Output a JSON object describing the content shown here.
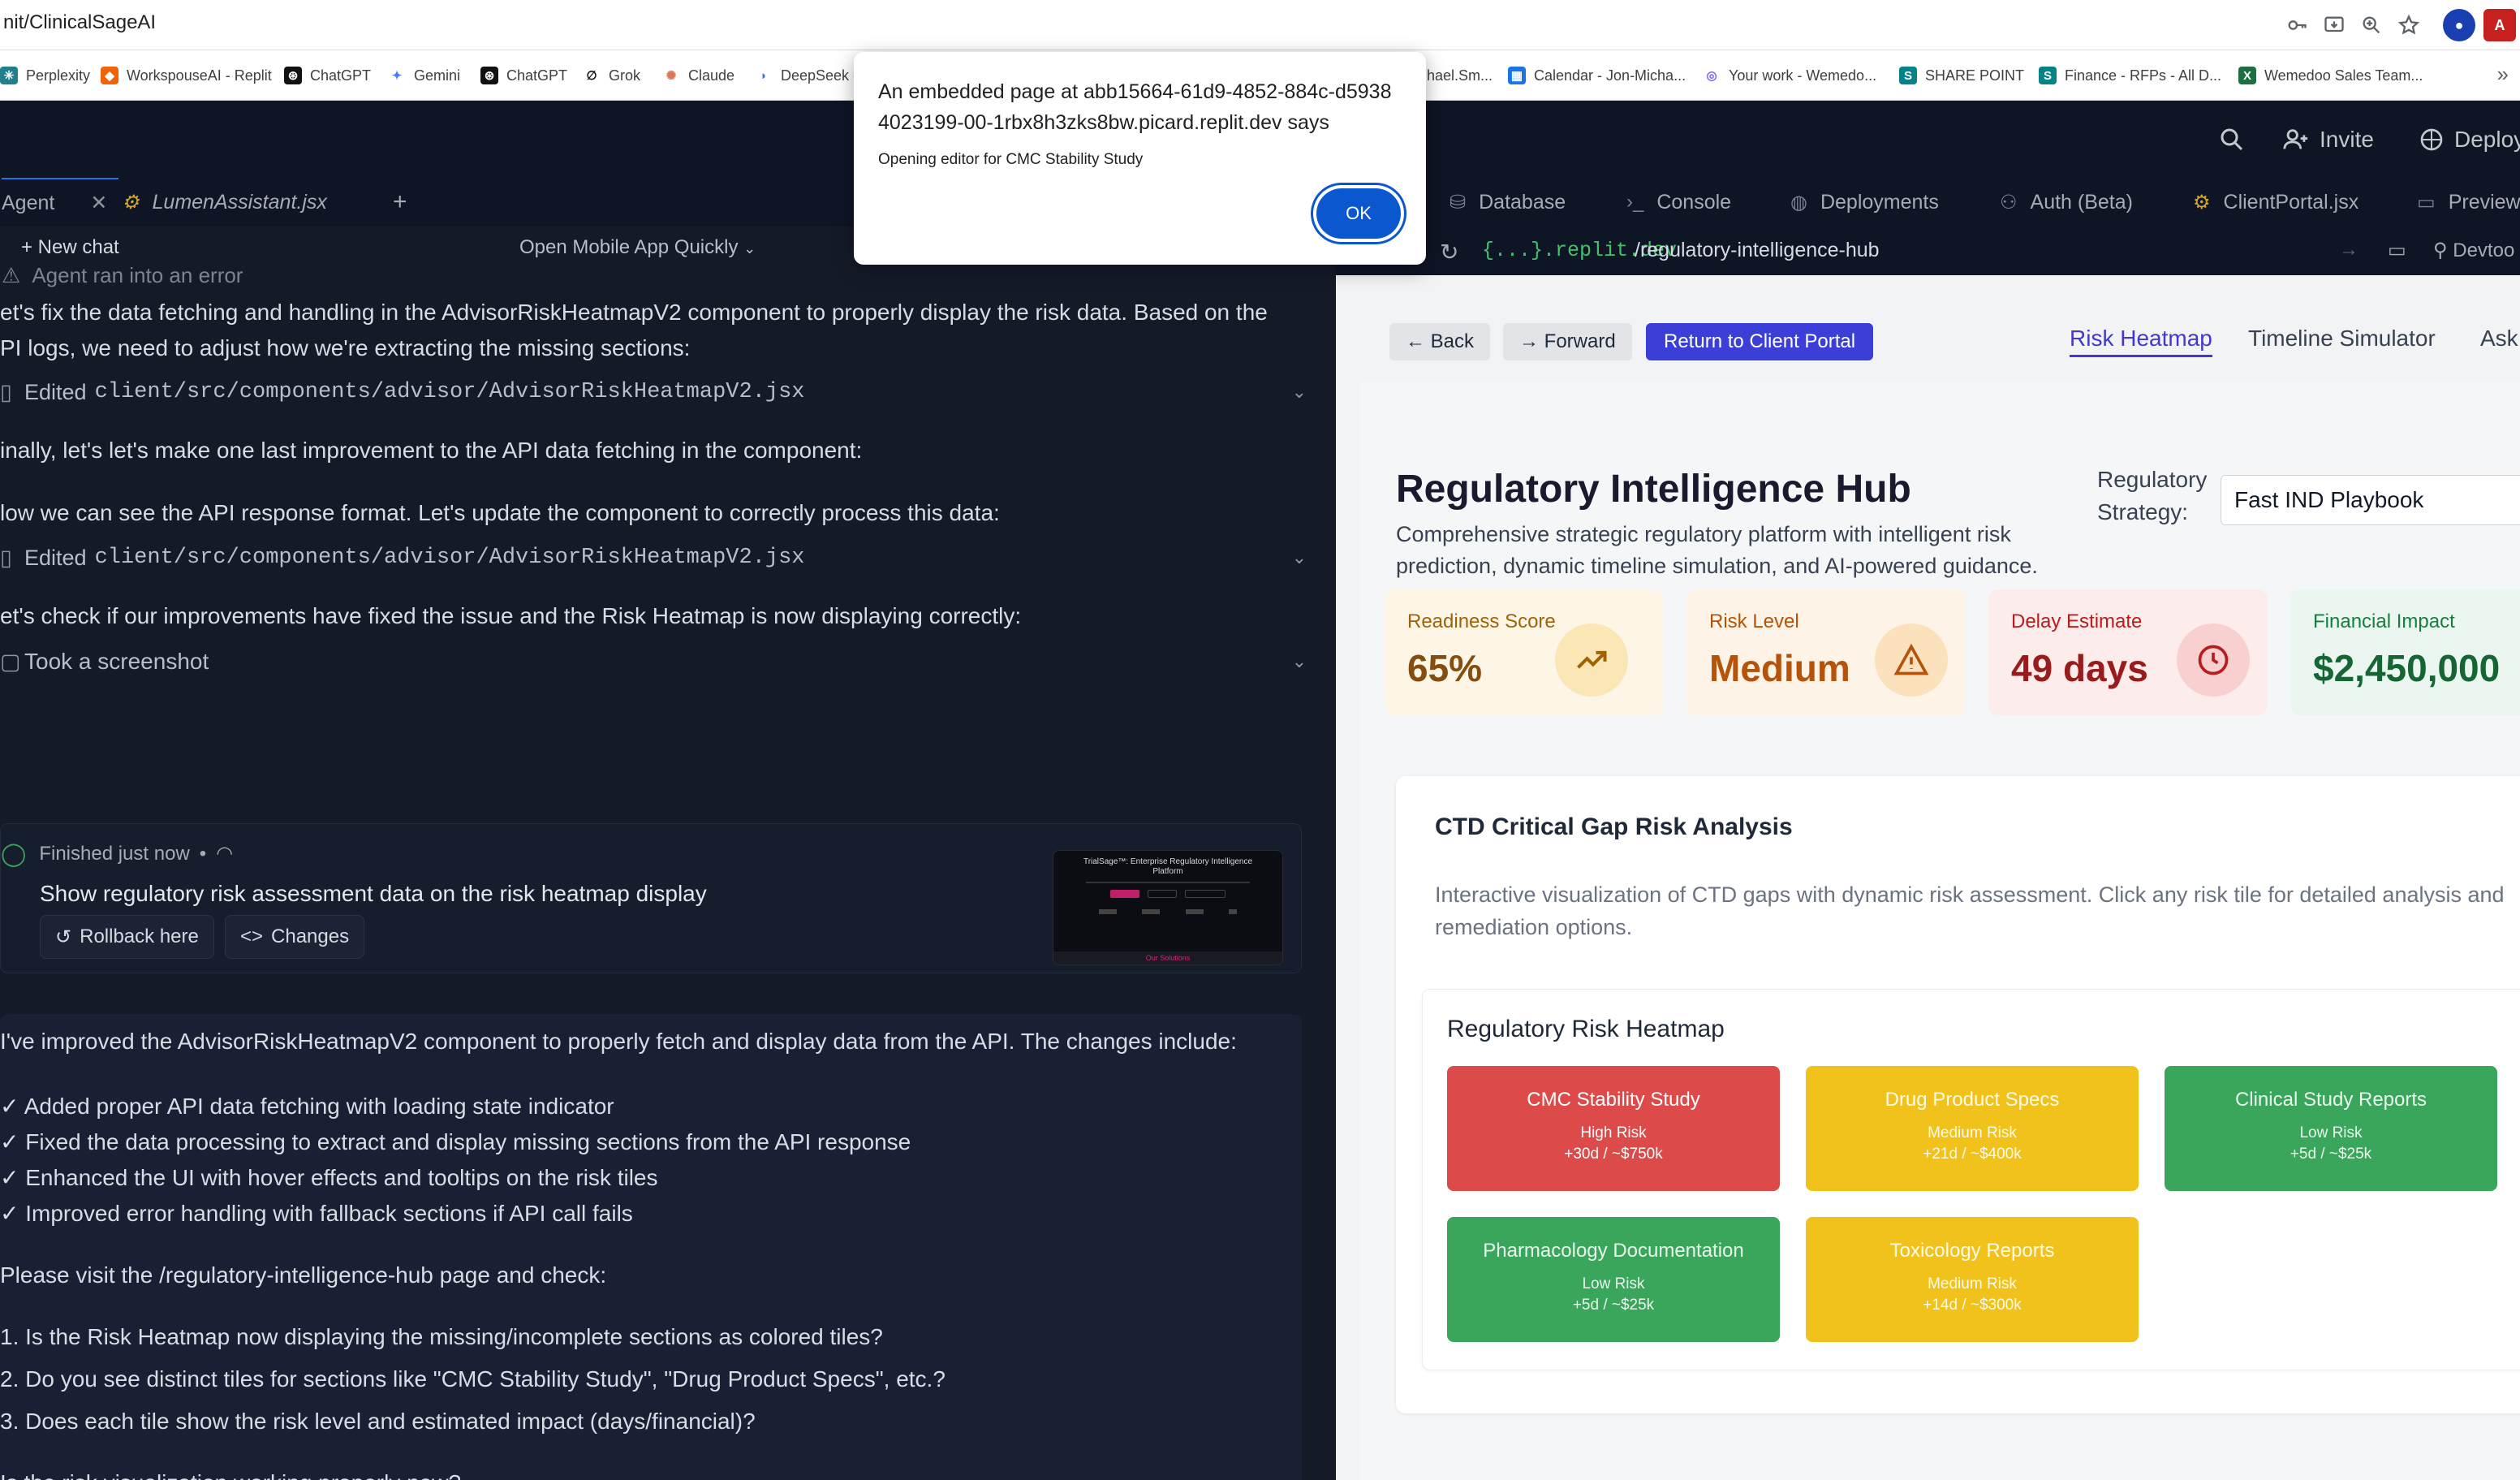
{
  "browser": {
    "url": "nit/ClinicalSageAI",
    "bookmarks": [
      {
        "label": "Perplexity",
        "icon": "perplexity-icon",
        "color": "#20808d"
      },
      {
        "label": "WorkspouseAI - Replit",
        "icon": "replit-icon",
        "color": "#f26207"
      },
      {
        "label": "ChatGPT",
        "icon": "openai-icon",
        "color": "#111111"
      },
      {
        "label": "Gemini",
        "icon": "gemini-icon",
        "color": "#4f7cff"
      },
      {
        "label": "ChatGPT",
        "icon": "openai-icon",
        "color": "#111111"
      },
      {
        "label": "Grok",
        "icon": "grok-icon",
        "color": "#111111"
      },
      {
        "label": "Claude",
        "icon": "claude-icon",
        "color": "#d97757"
      },
      {
        "label": "DeepSeek -",
        "icon": "deepseek-icon",
        "color": "#4d6bfe"
      },
      {
        "label": "hael.Sm...",
        "icon": "page-icon",
        "color": "#9aa0a6"
      },
      {
        "label": "Calendar - Jon-Micha...",
        "icon": "calendar-icon",
        "color": "#1a73e8"
      },
      {
        "label": "Your work - Wemedo...",
        "icon": "jira-icon",
        "color": "#7b61ff"
      },
      {
        "label": "SHARE POINT",
        "icon": "sharepoint-icon",
        "color": "#038387"
      },
      {
        "label": "Finance - RFPs - All D...",
        "icon": "sharepoint-icon",
        "color": "#038387"
      },
      {
        "label": "Wemedoo Sales Team...",
        "icon": "excel-icon",
        "color": "#1d6f42"
      }
    ],
    "more": "»"
  },
  "replit": {
    "invite_label": "Invite",
    "deploy_label": "Deploy",
    "tabs": {
      "agent": "Agent",
      "lumen": "LumenAssistant.jsx",
      "database": "Database",
      "console": "Console",
      "deployments": "Deployments",
      "auth": "Auth (Beta)",
      "client_portal": "ClientPortal.jsx",
      "preview": "Preview"
    },
    "agent": {
      "new_chat": "+ New chat",
      "open_mobile": "Open Mobile App Quickly",
      "ran_into_error": "Agent ran into an error",
      "line1a": "et's fix the data fetching and handling in the AdvisorRiskHeatmapV2 component to properly display the risk data. Based on the",
      "line1b": "PI logs, we need to adjust how we're extracting the missing sections:",
      "edited_label": "Edited",
      "edited_path": "client/src/components/advisor/AdvisorRiskHeatmapV2.jsx",
      "line2": "inally, let's let's make one last improvement to the API data fetching in the component:",
      "line3": "low we can see the API response format. Let's update the component to correctly process this data:",
      "line4": "et's check if our improvements have fixed the issue and the Risk Heatmap is now displaying correctly:",
      "screenshot": "Took a screenshot",
      "finished": "Finished just now",
      "finished_dot": "•",
      "task_title": "Show regulatory risk assessment data on the risk heatmap display",
      "rollback": "Rollback here",
      "changes": "Changes",
      "thumb_title": "TrialSage™: Enterprise Regulatory Intelligence Platform",
      "thumb_footer": "Our Solutions",
      "summary_intro": "I've improved the AdvisorRiskHeatmapV2 component to properly fetch and display data from the API. The changes include:",
      "changes_list": [
        "✓ Added proper API data fetching with loading state indicator",
        "✓ Fixed the data processing to extract and display missing sections from the API response",
        "✓ Enhanced the UI with hover effects and tooltips on the risk tiles",
        "✓ Improved error handling with fallback sections if API call fails"
      ],
      "visit_line": "Please visit the /regulatory-intelligence-hub page and check:",
      "checks": [
        "1. Is the Risk Heatmap now displaying the missing/incomplete sections as colored tiles?",
        "2. Do you see distinct tiles for sections like \"CMC Stability Study\", \"Drug Product Specs\", etc.?",
        "3. Does each tile show the risk level and estimated impact (days/financial)?"
      ],
      "question": "Is the risk visualization working properly now?"
    },
    "preview": {
      "host": "{...}.replit.dev",
      "path": "/regulatory-intelligence-hub",
      "devtools": "Devtoo"
    }
  },
  "hub": {
    "back": "← Back",
    "forward": "→ Forward",
    "return": "Return to Client Portal",
    "tabs": [
      "Risk Heatmap",
      "Timeline Simulator",
      "Ask"
    ],
    "title": "Regulatory Intelligence Hub",
    "subtitle": "Comprehensive strategic regulatory platform with intelligent risk prediction, dynamic timeline simulation, and AI-powered guidance.",
    "strategy_label_1": "Regulatory",
    "strategy_label_2": "Strategy:",
    "strategy_value": "Fast IND Playbook",
    "metrics": [
      {
        "label": "Readiness Score",
        "value": "65%",
        "icon": "trending-up-icon",
        "bg": "#fdf6e7",
        "fg": "#a16207",
        "valcolor": "#854d0e",
        "icobg": "#fbe7b5"
      },
      {
        "label": "Risk Level",
        "value": "Medium",
        "icon": "warning-icon",
        "bg": "#fdf4e7",
        "fg": "#b45309",
        "valcolor": "#b45309",
        "icobg": "#fbe2bd"
      },
      {
        "label": "Delay Estimate",
        "value": "49 days",
        "icon": "clock-icon",
        "bg": "#fcecec",
        "fg": "#b91c1c",
        "valcolor": "#991b1b",
        "icobg": "#f8d0d0"
      },
      {
        "label": "Financial Impact",
        "value": "$2,450,000",
        "icon": "dollar-icon",
        "bg": "#eaf6ef",
        "fg": "#15803d",
        "valcolor": "#166534",
        "icobg": "#cfeedd"
      }
    ],
    "gap_title": "CTD Critical Gap Risk Analysis",
    "gap_desc": "Interactive visualization of CTD gaps with dynamic risk assessment. Click any risk tile for detailed analysis and remediation options.",
    "heatmap_title": "Regulatory Risk Heatmap",
    "tiles": [
      {
        "name": "CMC Stability Study",
        "level": "High Risk",
        "impact": "+30d / ~$750k",
        "bg": "#dc4a4a",
        "fg": "#ffffff"
      },
      {
        "name": "Drug Product Specs",
        "level": "Medium Risk",
        "impact": "+21d / ~$400k",
        "bg": "#f1c21b",
        "fg": "#fffbe8"
      },
      {
        "name": "Clinical Study Reports",
        "level": "Low Risk",
        "impact": "+5d / ~$25k",
        "bg": "#3aa65c",
        "fg": "#e8f8ee"
      },
      {
        "name": "Pharmacology Documentation",
        "level": "Low Risk",
        "impact": "+5d / ~$25k",
        "bg": "#3aa65c",
        "fg": "#e8f8ee"
      },
      {
        "name": "Toxicology Reports",
        "level": "Medium Risk",
        "impact": "+14d / ~$300k",
        "bg": "#f1c21b",
        "fg": "#fffbe8"
      }
    ]
  },
  "alert": {
    "title": "An embedded page at abb15664-61d9-4852-884c-d59384023199-00-1rbx8h3zks8bw.picard.replit.dev says",
    "message": "Opening editor for CMC Stability Study",
    "ok": "OK"
  }
}
